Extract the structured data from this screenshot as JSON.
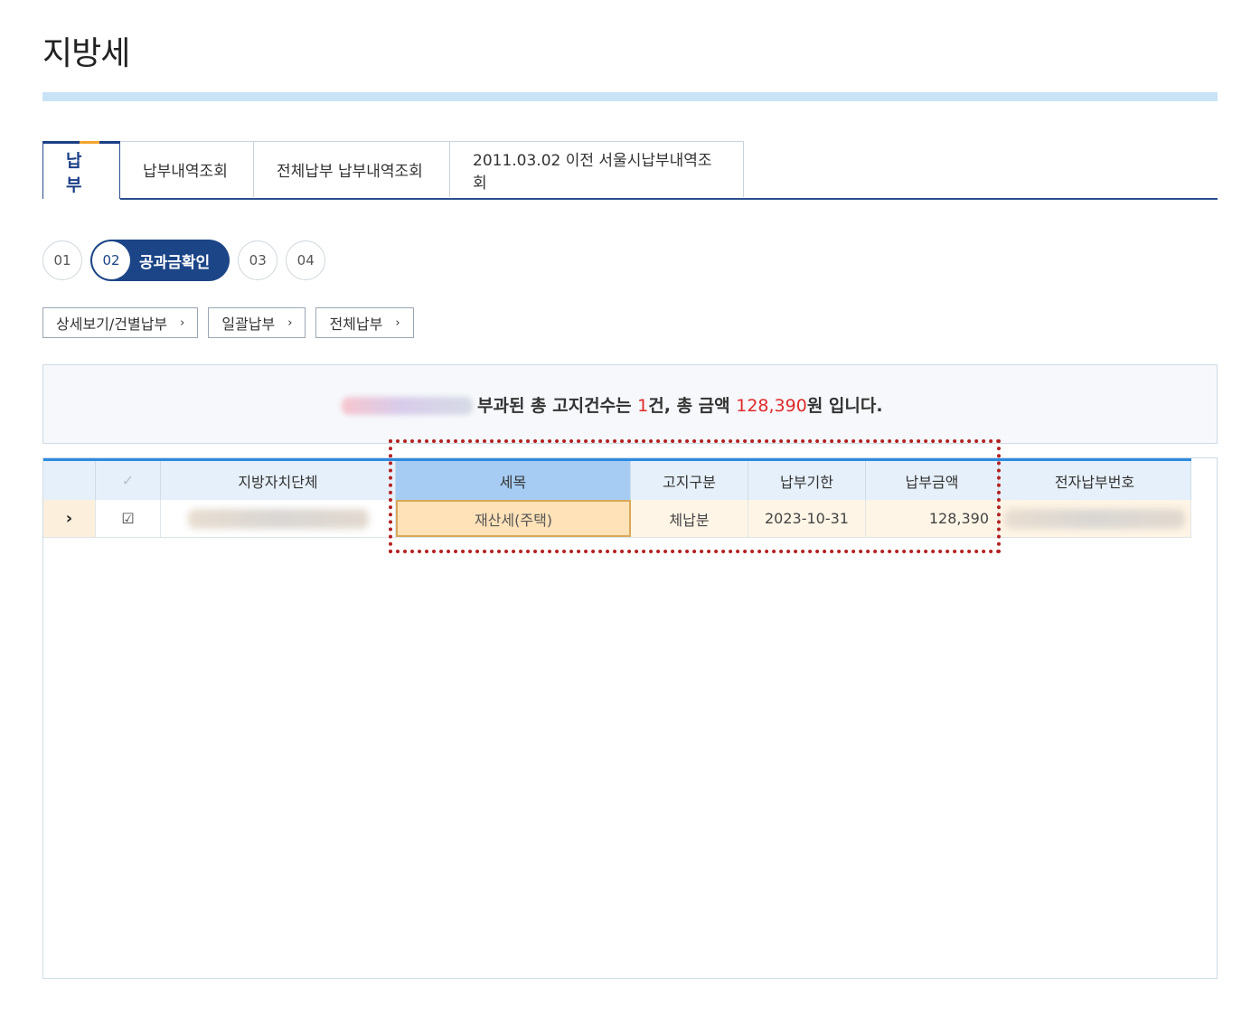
{
  "page": {
    "title": "지방세"
  },
  "tabs": [
    {
      "label": "납부",
      "active": true
    },
    {
      "label": "납부내역조회"
    },
    {
      "label": "전체납부 납부내역조회"
    },
    {
      "label": "2011.03.02 이전 서울시납부내역조회"
    }
  ],
  "steps": {
    "s1": "01",
    "s2": "02",
    "s2_label": "공과금확인",
    "s3": "03",
    "s4": "04"
  },
  "buttons": {
    "detail": "상세보기/건별납부",
    "bulk": "일괄납부",
    "all": "전체납부",
    "chevron": "›"
  },
  "summary": {
    "prefix": "부과된 총 고지건수는 ",
    "count": "1",
    "mid": "건, 총 금액 ",
    "amount": "128,390",
    "suffix": "원 입니다."
  },
  "grid": {
    "headers": {
      "check": "✓",
      "municipality": "지방자치단체",
      "tax_item": "세목",
      "notice_type": "고지구분",
      "due_date": "납부기한",
      "amount": "납부금액",
      "e_number": "전자납부번호"
    },
    "rows": [
      {
        "expand": "›",
        "checked": "☑",
        "tax_item": "재산세(주택)",
        "notice_type": "체납분",
        "due_date": "2023-10-31",
        "amount": "128,390"
      }
    ]
  },
  "colors": {
    "primary": "#1c4587",
    "accent_red": "#e12a2a",
    "highlight": "#b32121"
  }
}
